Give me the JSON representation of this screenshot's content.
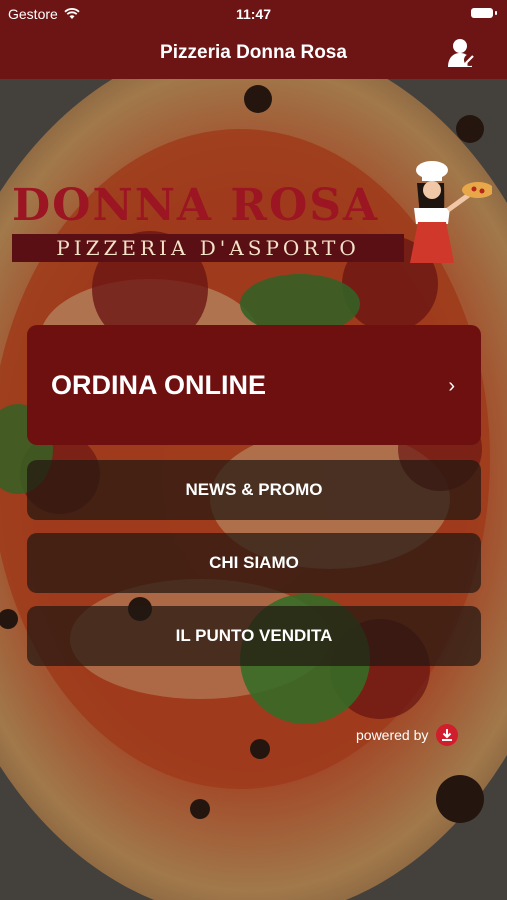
{
  "status_bar": {
    "carrier": "Gestore",
    "time": "11:47"
  },
  "nav_bar": {
    "title": "Pizzeria Donna Rosa",
    "profile_icon": "user-profile-icon"
  },
  "logo": {
    "name": "DONNA ROSA",
    "subtitle": "PIZZERIA D'ASPORTO"
  },
  "menu": {
    "primary": {
      "label": "ORDINA ONLINE",
      "chevron": "›"
    },
    "items": [
      {
        "label": "NEWS & PROMO"
      },
      {
        "label": "CHI SIAMO"
      },
      {
        "label": "IL PUNTO VENDITA"
      }
    ]
  },
  "footer": {
    "powered_by": "powered by"
  },
  "colors": {
    "brand": "#6d1414",
    "button_dark": "#231812",
    "logo_red": "#9b1622"
  }
}
